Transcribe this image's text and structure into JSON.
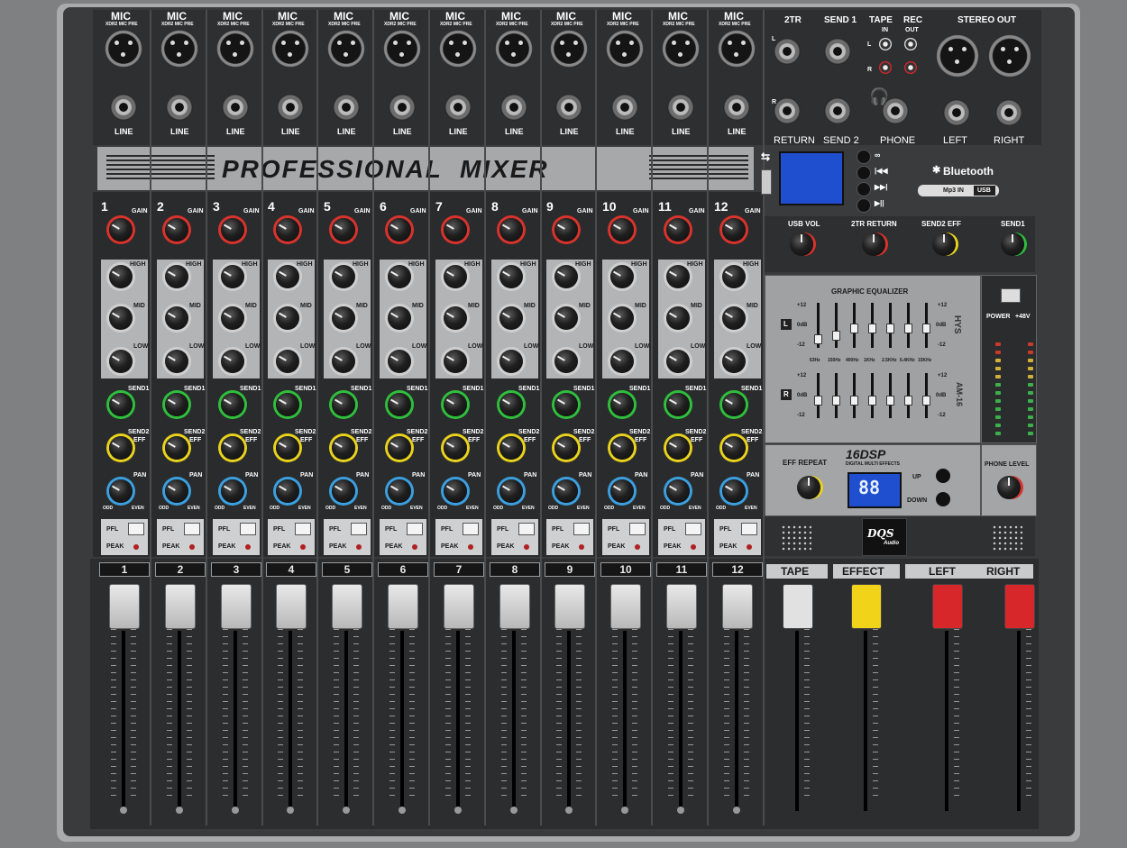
{
  "channels": [
    "1",
    "2",
    "3",
    "4",
    "5",
    "6",
    "7",
    "8",
    "9",
    "10",
    "11",
    "12"
  ],
  "top_labels": {
    "mic": "MIC",
    "mic_sub": "XDR2 MIC PRE",
    "line": "LINE",
    "return_header": "2TR",
    "send1_header": "SEND 1",
    "tape_header": "TAPE",
    "rec_header": "REC",
    "in": "IN",
    "out": "OUT",
    "stereo_out_header": "STEREO OUT",
    "return": "RETURN",
    "send2": "SEND 2",
    "phone": "PHONE",
    "left": "LEFT",
    "right": "RIGHT",
    "l": "L",
    "r": "R"
  },
  "title": "PROFESSIONAL  MIXER",
  "usb_module": {
    "bluetooth": "Bluetooth",
    "mp3_in": "Mp3 IN",
    "usb": "USB"
  },
  "strip_labels": {
    "gain": "GAIN",
    "high": "HIGH",
    "mid": "MID",
    "low": "LOW",
    "send1": "SEND1",
    "send2": "SEND2",
    "eff": "EFF",
    "pan": "PAN",
    "pfl": "PFL",
    "peak": "PEAK",
    "odd": "ODD",
    "even": "EVEN"
  },
  "master_knobs": {
    "usb_vol": "USB VOL",
    "two_tr_return": "2TR RETURN",
    "send2_eff": "SEND2 EFF",
    "send1": "SEND1"
  },
  "graphic_eq": {
    "title": "GRAPHIC EQUALIZER",
    "plus": "+12",
    "zero": "0dB",
    "minus": "-12",
    "left": "L",
    "right": "R",
    "freqs": [
      "63Hz",
      "150Hz",
      "400Hz",
      "1KHz",
      "2.5KHz",
      "6.4KHz",
      "15KHz"
    ],
    "brand": "HYS",
    "model": "AM-16"
  },
  "power": {
    "label": "POWER",
    "phantom": "+48V"
  },
  "dsp": {
    "eff_repeat": "EFF REPEAT",
    "badge": "16DSP",
    "badge_sub": "DIGITAL MULTI EFFECTS",
    "display": "88",
    "up": "UP",
    "down": "DOWN"
  },
  "phone_level": "PHONE LEVEL",
  "logo": "DQS",
  "logo_sub": "Audio",
  "master_faders": {
    "tape": "TAPE",
    "effect": "EFFECT",
    "left": "LEFT",
    "right": "RIGHT"
  },
  "colors": {
    "gain_knob": "#d9332c",
    "send1_knob": "#2fbf3c",
    "send2_knob": "#e8d21d",
    "pan_knob": "#3ba0e0",
    "effect_cap": "#f1d31a",
    "stereo_cap": "#d8272b",
    "lcd": "#1f4fcf"
  }
}
